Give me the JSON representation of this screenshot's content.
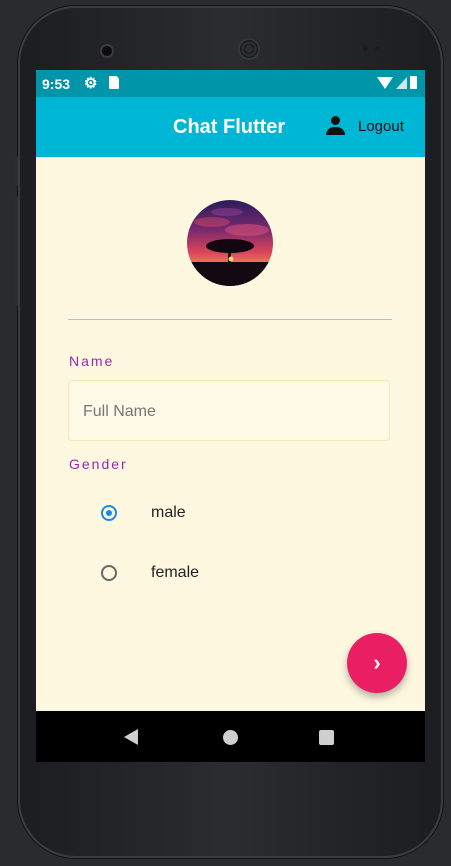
{
  "status_bar": {
    "time": "9:53",
    "icons": [
      "gear-icon",
      "sd-card-icon",
      "wifi-icon",
      "signal-icon",
      "battery-icon"
    ]
  },
  "app_bar": {
    "title": "Chat Flutter",
    "logout_label": "Logout",
    "logout_icon": "person-icon",
    "color": "#00b6d5"
  },
  "form": {
    "name_label": "Name",
    "name_placeholder": "Full Name",
    "name_value": "",
    "gender_label": "Gender",
    "gender_options": [
      {
        "label": "male",
        "selected": true
      },
      {
        "label": "female",
        "selected": false
      }
    ]
  },
  "fab": {
    "icon": "chevron-right-icon",
    "color": "#ea1f63"
  },
  "colors": {
    "background": "#fef8e1",
    "label_accent": "#9c27b0",
    "radio_selected": "#1e88e5"
  },
  "nav_bar": {
    "icons": [
      "back-icon",
      "home-icon",
      "recents-icon"
    ]
  }
}
